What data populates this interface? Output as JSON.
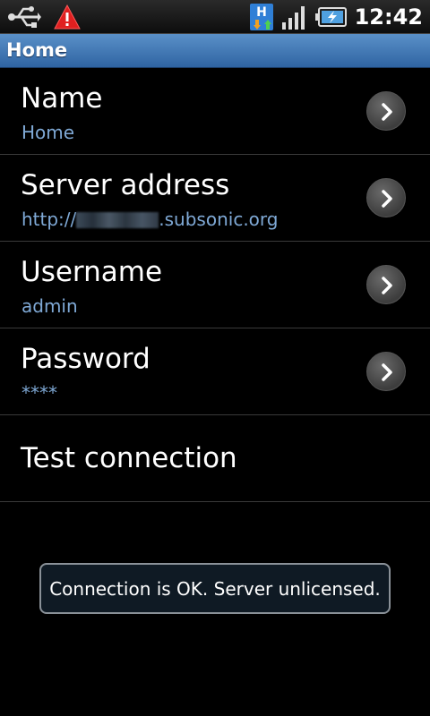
{
  "status_bar": {
    "time": "12:42",
    "icons": [
      "usb-icon",
      "warning-icon",
      "h-transfer-icon",
      "signal-icon",
      "battery-charging-icon"
    ]
  },
  "title_bar": {
    "title": "Home"
  },
  "preferences": [
    {
      "title": "Name",
      "summary": "Home",
      "icon": "chevron-right-icon"
    },
    {
      "title": "Server address",
      "summary_prefix": "http://",
      "summary_suffix": ".subsonic.org",
      "icon": "chevron-right-icon"
    },
    {
      "title": "Username",
      "summary": "admin",
      "icon": "chevron-right-icon"
    },
    {
      "title": "Password",
      "summary": "****",
      "icon": "chevron-right-icon"
    },
    {
      "title": "Test connection"
    }
  ],
  "toast": {
    "message": "Connection is OK. Server unlicensed."
  },
  "colors": {
    "title_bar": "#3c74b4",
    "summary_text": "#7fa9d6",
    "background": "#000000"
  }
}
